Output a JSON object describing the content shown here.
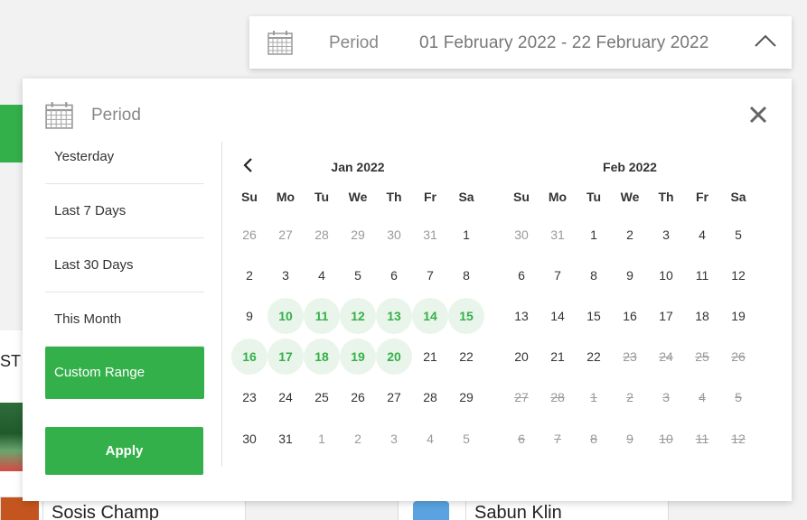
{
  "background": {
    "partial_text": "ST",
    "cards": [
      "Sosis Champ",
      "Sabun Klin"
    ]
  },
  "trigger": {
    "label": "Period",
    "range": "01 February 2022 - 22 February 2022",
    "icon": "calendar-icon",
    "toggle_icon": "chevron-up-icon"
  },
  "panel": {
    "label": "Period",
    "close_icon": "close-icon",
    "presets": [
      {
        "label": "Yesterday",
        "active": false
      },
      {
        "label": "Last 7 Days",
        "active": false
      },
      {
        "label": "Last 30 Days",
        "active": false
      },
      {
        "label": "This Month",
        "active": false
      },
      {
        "label": "Custom Range",
        "active": true
      }
    ],
    "apply_label": "Apply",
    "weekdays": [
      "Su",
      "Mo",
      "Tu",
      "We",
      "Th",
      "Fr",
      "Sa"
    ],
    "months": [
      {
        "title": "Jan 2022",
        "has_prev": true,
        "days": [
          {
            "d": "26",
            "s": "other"
          },
          {
            "d": "27",
            "s": "other"
          },
          {
            "d": "28",
            "s": "other"
          },
          {
            "d": "29",
            "s": "other"
          },
          {
            "d": "30",
            "s": "other"
          },
          {
            "d": "31",
            "s": "other"
          },
          {
            "d": "1",
            "s": "normal"
          },
          {
            "d": "2",
            "s": "normal"
          },
          {
            "d": "3",
            "s": "normal"
          },
          {
            "d": "4",
            "s": "normal"
          },
          {
            "d": "5",
            "s": "normal"
          },
          {
            "d": "6",
            "s": "normal"
          },
          {
            "d": "7",
            "s": "normal"
          },
          {
            "d": "8",
            "s": "normal"
          },
          {
            "d": "9",
            "s": "normal"
          },
          {
            "d": "10",
            "s": "sel"
          },
          {
            "d": "11",
            "s": "sel"
          },
          {
            "d": "12",
            "s": "sel"
          },
          {
            "d": "13",
            "s": "sel"
          },
          {
            "d": "14",
            "s": "sel"
          },
          {
            "d": "15",
            "s": "sel"
          },
          {
            "d": "16",
            "s": "sel"
          },
          {
            "d": "17",
            "s": "sel"
          },
          {
            "d": "18",
            "s": "sel"
          },
          {
            "d": "19",
            "s": "sel"
          },
          {
            "d": "20",
            "s": "sel"
          },
          {
            "d": "21",
            "s": "normal"
          },
          {
            "d": "22",
            "s": "normal"
          },
          {
            "d": "23",
            "s": "normal"
          },
          {
            "d": "24",
            "s": "normal"
          },
          {
            "d": "25",
            "s": "normal"
          },
          {
            "d": "26",
            "s": "normal"
          },
          {
            "d": "27",
            "s": "normal"
          },
          {
            "d": "28",
            "s": "normal"
          },
          {
            "d": "29",
            "s": "normal"
          },
          {
            "d": "30",
            "s": "normal"
          },
          {
            "d": "31",
            "s": "normal"
          },
          {
            "d": "1",
            "s": "other"
          },
          {
            "d": "2",
            "s": "other"
          },
          {
            "d": "3",
            "s": "other"
          },
          {
            "d": "4",
            "s": "other"
          },
          {
            "d": "5",
            "s": "other"
          }
        ]
      },
      {
        "title": "Feb 2022",
        "has_prev": false,
        "days": [
          {
            "d": "30",
            "s": "other"
          },
          {
            "d": "31",
            "s": "other"
          },
          {
            "d": "1",
            "s": "normal"
          },
          {
            "d": "2",
            "s": "normal"
          },
          {
            "d": "3",
            "s": "normal"
          },
          {
            "d": "4",
            "s": "normal"
          },
          {
            "d": "5",
            "s": "normal"
          },
          {
            "d": "6",
            "s": "normal"
          },
          {
            "d": "7",
            "s": "normal"
          },
          {
            "d": "8",
            "s": "normal"
          },
          {
            "d": "9",
            "s": "normal"
          },
          {
            "d": "10",
            "s": "normal"
          },
          {
            "d": "11",
            "s": "normal"
          },
          {
            "d": "12",
            "s": "normal"
          },
          {
            "d": "13",
            "s": "normal"
          },
          {
            "d": "14",
            "s": "normal"
          },
          {
            "d": "15",
            "s": "normal"
          },
          {
            "d": "16",
            "s": "normal"
          },
          {
            "d": "17",
            "s": "normal"
          },
          {
            "d": "18",
            "s": "normal"
          },
          {
            "d": "19",
            "s": "normal"
          },
          {
            "d": "20",
            "s": "normal"
          },
          {
            "d": "21",
            "s": "normal"
          },
          {
            "d": "22",
            "s": "normal"
          },
          {
            "d": "23",
            "s": "disabled"
          },
          {
            "d": "24",
            "s": "disabled"
          },
          {
            "d": "25",
            "s": "disabled"
          },
          {
            "d": "26",
            "s": "disabled"
          },
          {
            "d": "27",
            "s": "disabled"
          },
          {
            "d": "28",
            "s": "disabled"
          },
          {
            "d": "1",
            "s": "disabled"
          },
          {
            "d": "2",
            "s": "disabled"
          },
          {
            "d": "3",
            "s": "disabled"
          },
          {
            "d": "4",
            "s": "disabled"
          },
          {
            "d": "5",
            "s": "disabled"
          },
          {
            "d": "6",
            "s": "disabled"
          },
          {
            "d": "7",
            "s": "disabled"
          },
          {
            "d": "8",
            "s": "disabled"
          },
          {
            "d": "9",
            "s": "disabled"
          },
          {
            "d": "10",
            "s": "disabled"
          },
          {
            "d": "11",
            "s": "disabled"
          },
          {
            "d": "12",
            "s": "disabled"
          }
        ]
      }
    ]
  },
  "colors": {
    "accent": "#34b04a",
    "selected_bg": "#e9f5ea",
    "muted_text": "#999999"
  }
}
